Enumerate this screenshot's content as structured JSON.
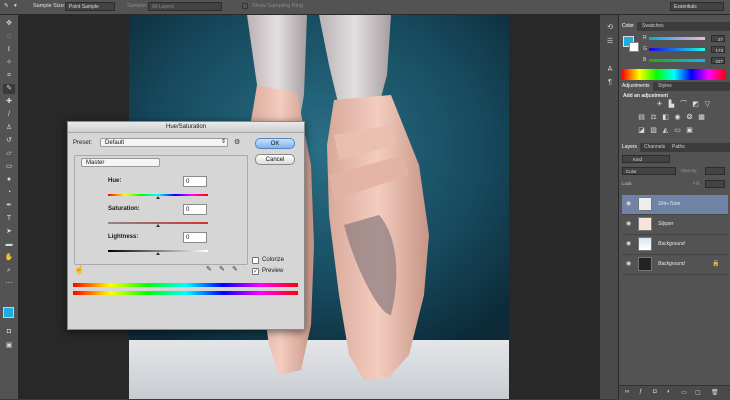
{
  "options_bar": {
    "sample_size_label": "Sample Size:",
    "sample_size_value": "Point Sample",
    "sample_label": "Sample:",
    "sample_value": "All Layers",
    "show_sampling_ring": "Show Sampling Ring",
    "workspace": "Essentials"
  },
  "color_panel": {
    "tabs": [
      "Color",
      "Swatches"
    ],
    "r": "27",
    "g": "173",
    "b": "227",
    "r_label": "R",
    "g_label": "G",
    "b_label": "B",
    "foreground_color": "#1badE3"
  },
  "adjustments_panel": {
    "tabs": [
      "Adjustments",
      "Styles"
    ],
    "heading": "Add an adjustment"
  },
  "layers_panel": {
    "tabs": [
      "Layers",
      "Channels",
      "Paths"
    ],
    "kind": "Kind",
    "blend_mode": "Color",
    "opacity_label": "Opacity:",
    "lock_label": "Lock:",
    "fill_label": "Fill:",
    "layers": [
      {
        "name": "Skin-Tone",
        "selected": true
      },
      {
        "name": "Slipper",
        "selected": false
      },
      {
        "name": "Background",
        "selected": false
      },
      {
        "name": "Background",
        "selected": false
      }
    ]
  },
  "dialog": {
    "title": "Hue/Saturation",
    "preset_label": "Preset:",
    "preset_value": "Default",
    "channel_value": "Master",
    "hue_label": "Hue:",
    "hue_value": "0",
    "saturation_label": "Saturation:",
    "saturation_value": "0",
    "lightness_label": "Lightness:",
    "lightness_value": "0",
    "ok_label": "OK",
    "cancel_label": "Cancel",
    "colorize_label": "Colorize",
    "colorize_checked": false,
    "preview_label": "Preview",
    "preview_checked": true
  }
}
